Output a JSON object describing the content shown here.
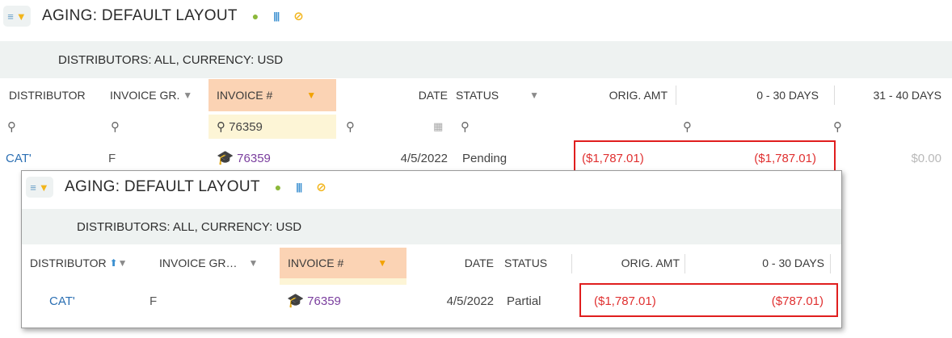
{
  "main": {
    "title": "AGING: DEFAULT LAYOUT",
    "band": "DISTRIBUTORS: ALL, CURRENCY: USD",
    "headers": {
      "distributor": "DISTRIBUTOR",
      "invoice_group": "INVOICE GR.",
      "invoice_num": "INVOICE #",
      "date": "DATE",
      "status": "STATUS",
      "orig_amt": "ORIG. AMT",
      "d0_30": "0 - 30 DAYS",
      "d31_40": "31 - 40 DAYS"
    },
    "filter": {
      "invoice_value": "76359"
    },
    "row": {
      "distributor": "CAT'",
      "invoice_group": "F",
      "invoice_num": "76359",
      "date": "4/5/2022",
      "status": "Pending",
      "orig_amt": "($1,787.01)",
      "d0_30": "($1,787.01)",
      "d31_40": "$0.00"
    }
  },
  "overlay": {
    "title": "AGING: DEFAULT LAYOUT",
    "band": "DISTRIBUTORS: ALL, CURRENCY: USD",
    "headers": {
      "distributor": "DISTRIBUTOR",
      "invoice_group": "INVOICE GR…",
      "invoice_num": "INVOICE #",
      "date": "DATE",
      "status": "STATUS",
      "orig_amt": "ORIG. AMT",
      "d0_30": "0 - 30 DAYS"
    },
    "row": {
      "distributor": "CAT'",
      "invoice_group": "F",
      "invoice_num": "76359",
      "date": "4/5/2022",
      "status": "Partial",
      "orig_amt": "($1,787.01)",
      "d0_30": "($787.01)"
    }
  },
  "icons": {
    "menu": "list-icon",
    "filter": "funnel-icon",
    "info": "info-icon",
    "columns": "columns-icon",
    "percent": "percent-icon",
    "search": "search-icon",
    "calendar": "calendar-icon",
    "graduate": "graduation-cap-icon",
    "sort": "sort-up-icon"
  },
  "colors": {
    "negative": "#e03030",
    "highlight_header": "#fbd3b4",
    "highlight_filter": "#fdf5d6",
    "link": "#2b6fb3",
    "invoice": "#7a3e9e",
    "annotation_box": "#e01e1e"
  }
}
